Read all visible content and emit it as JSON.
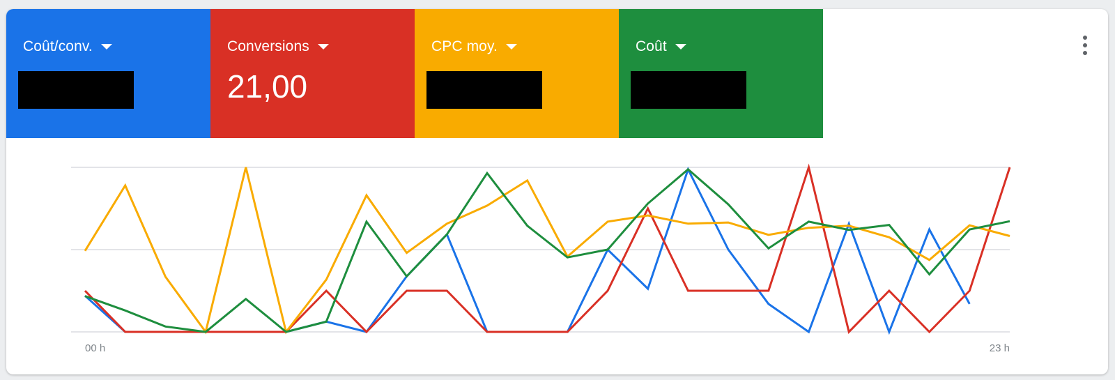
{
  "metrics": [
    {
      "label": "Coût/conv.",
      "value": "",
      "color": "#1a73e8",
      "redacted": true
    },
    {
      "label": "Conversions",
      "value": "21,00",
      "color": "#d93025",
      "redacted": false
    },
    {
      "label": "CPC moy.",
      "value": "",
      "color": "#f9ab00",
      "redacted": true
    },
    {
      "label": "Coût",
      "value": "",
      "color": "#1e8e3e",
      "redacted": true
    }
  ],
  "more_icon": "more-vert-icon",
  "chart_data": {
    "type": "line",
    "x": [
      0,
      1,
      2,
      3,
      4,
      5,
      6,
      7,
      8,
      9,
      10,
      11,
      12,
      13,
      14,
      15,
      16,
      17,
      18,
      19,
      20,
      21,
      22,
      23
    ],
    "xlabel": "",
    "ylabel": "",
    "ylim": [
      0,
      4
    ],
    "grid": true,
    "x_tick_labels": [
      {
        "index": 0,
        "text": "00 h"
      },
      {
        "index": 23,
        "text": "23 h"
      }
    ],
    "series": [
      {
        "color": "#1a73e8",
        "values": [
          0.88,
          0,
          0,
          0,
          0,
          0,
          0.25,
          0,
          1.35,
          2.37,
          0,
          0,
          0,
          2.0,
          1.05,
          3.95,
          2.0,
          0.68,
          0,
          2.63,
          0,
          2.49,
          0.68,
          null
        ]
      },
      {
        "color": "#d93025",
        "values": [
          1.0,
          0,
          0,
          0,
          0,
          0,
          1.0,
          0,
          1.0,
          1.0,
          0,
          0,
          0,
          1.0,
          3.0,
          1.0,
          1.0,
          1.0,
          4.0,
          0,
          1.0,
          0,
          1.0,
          4.0
        ]
      },
      {
        "color": "#f9ab00",
        "values": [
          1.97,
          3.56,
          1.34,
          0,
          4.0,
          0,
          1.27,
          3.32,
          1.92,
          2.63,
          3.07,
          3.68,
          1.83,
          2.68,
          2.83,
          2.63,
          2.66,
          2.36,
          2.53,
          2.58,
          2.3,
          1.75,
          2.59,
          2.33
        ]
      },
      {
        "color": "#1e8e3e",
        "values": [
          0.87,
          0.52,
          0.13,
          0,
          0.8,
          0,
          0.25,
          2.68,
          1.35,
          2.37,
          3.86,
          2.58,
          1.81,
          2.0,
          3.12,
          3.95,
          3.1,
          2.03,
          2.68,
          2.48,
          2.6,
          1.4,
          2.49,
          2.69
        ]
      }
    ]
  }
}
